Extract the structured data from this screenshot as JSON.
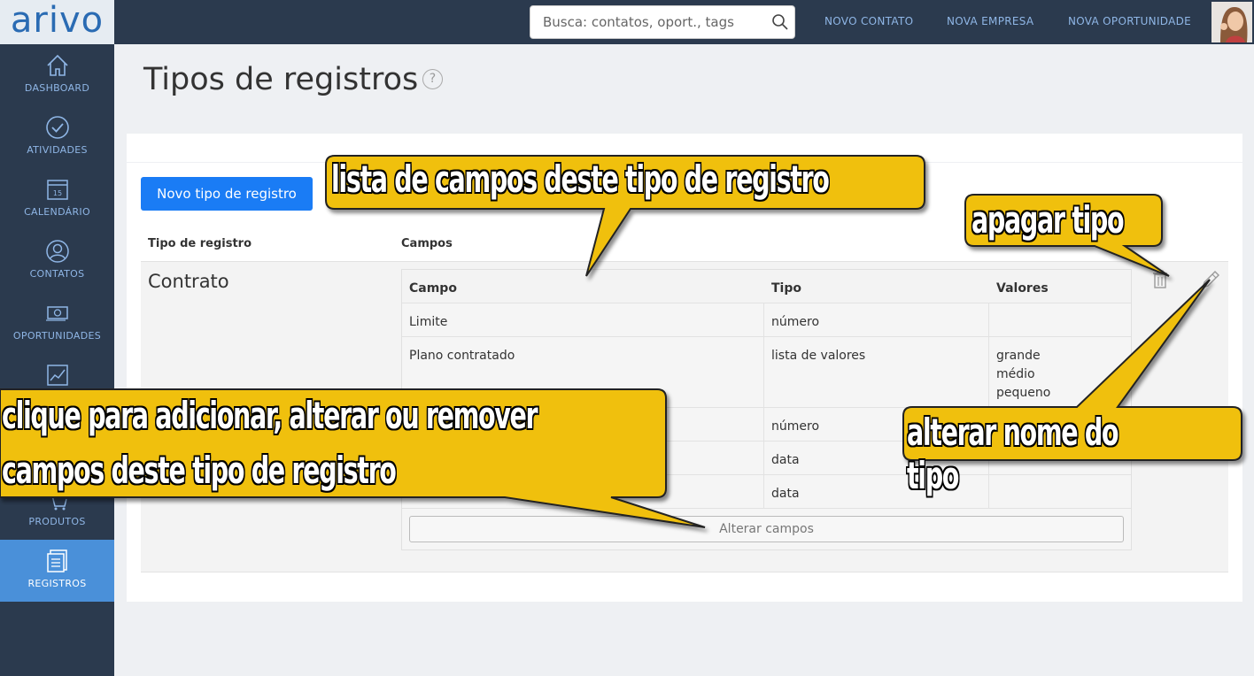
{
  "app": {
    "logo": "arivo"
  },
  "search": {
    "placeholder": "Busca: contatos, oport., tags"
  },
  "topnav": [
    {
      "label": "NOVO CONTATO"
    },
    {
      "label": "NOVA EMPRESA"
    },
    {
      "label": "NOVA OPORTUNIDADE"
    }
  ],
  "sidebar": {
    "items": [
      {
        "label": "DASHBOARD",
        "icon": "home-icon"
      },
      {
        "label": "ATIVIDADES",
        "icon": "check-circle-icon"
      },
      {
        "label": "CALENDÁRIO",
        "icon": "calendar-icon",
        "day": "15"
      },
      {
        "label": "CONTATOS",
        "icon": "person-icon"
      },
      {
        "label": "OPORTUNIDADES",
        "icon": "money-icon"
      },
      {
        "label": "",
        "icon": "chart-icon"
      },
      {
        "label": "",
        "icon": "hidden-icon"
      },
      {
        "label": "PRODUTOS",
        "icon": "cart-icon"
      },
      {
        "label": "REGISTROS",
        "icon": "records-icon",
        "active": true
      }
    ]
  },
  "page": {
    "title": "Tipos de registros",
    "help": "?",
    "new_button": "Novo tipo de registro",
    "col_tipo": "Tipo de registro",
    "col_campos": "Campos"
  },
  "record": {
    "name": "Contrato",
    "fields_header": {
      "campo": "Campo",
      "tipo": "Tipo",
      "valores": "Valores"
    },
    "fields": [
      {
        "campo": "Limite",
        "tipo": "número",
        "valores": ""
      },
      {
        "campo": "Plano contratado",
        "tipo": "lista de valores",
        "valores": "grande\nmédio\npequeno"
      },
      {
        "campo": "",
        "tipo": "número",
        "valores": ""
      },
      {
        "campo": "",
        "tipo": "data",
        "valores": ""
      },
      {
        "campo": "",
        "tipo": "data",
        "valores": ""
      }
    ],
    "alter_button": "Alterar campos"
  },
  "callouts": {
    "lista": "lista de campos deste tipo de registro",
    "apagar": "apagar tipo",
    "clique_1": "clique para adicionar, alterar ou remover",
    "clique_2": "campos deste tipo de registro",
    "alterar_nome": "alterar nome do tipo"
  },
  "colors": {
    "topbar": "#2b3a4e",
    "accent": "#1a7cf5",
    "active": "#4a90d9",
    "callout": "#f0c010"
  }
}
